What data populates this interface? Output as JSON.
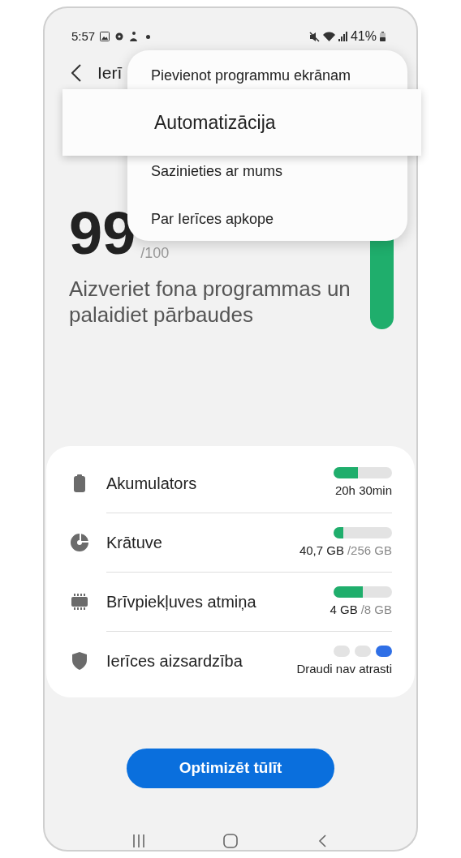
{
  "status_bar": {
    "time": "5:57",
    "battery": "41%"
  },
  "header": {
    "title": "Ierī"
  },
  "score": {
    "value": "99",
    "max": "/100",
    "message": "Aizveriet fona programmas un palaidiet pārbaudes"
  },
  "menu": {
    "items": [
      {
        "label": "Pievienot programmu ekrānam",
        "magnified": false
      },
      {
        "label": "Automatizācija",
        "magnified": true
      },
      {
        "label": "Sazinieties ar mums",
        "magnified": false
      },
      {
        "label": "Par Ierīces apkope",
        "magnified": false
      }
    ]
  },
  "rows": [
    {
      "kind": "bar",
      "label": "Akumulators",
      "level": 0.41,
      "value": "20h 30min"
    },
    {
      "kind": "bar",
      "label": "Krātuve",
      "level": 0.16,
      "value": "40,7 GB",
      "total": "/256 GB"
    },
    {
      "kind": "bar",
      "label": "Brīvpiekļuves atmiņa",
      "level": 0.5,
      "value": "4 GB",
      "total": "/8 GB"
    },
    {
      "kind": "dots",
      "label": "Ierīces aizsardzība",
      "dots": [
        {
          "selected": false
        },
        {
          "selected": false
        },
        {
          "selected": true
        }
      ],
      "value": "Draudi nav atrasti"
    }
  ],
  "button": {
    "label": "Optimizēt tūlīt"
  }
}
